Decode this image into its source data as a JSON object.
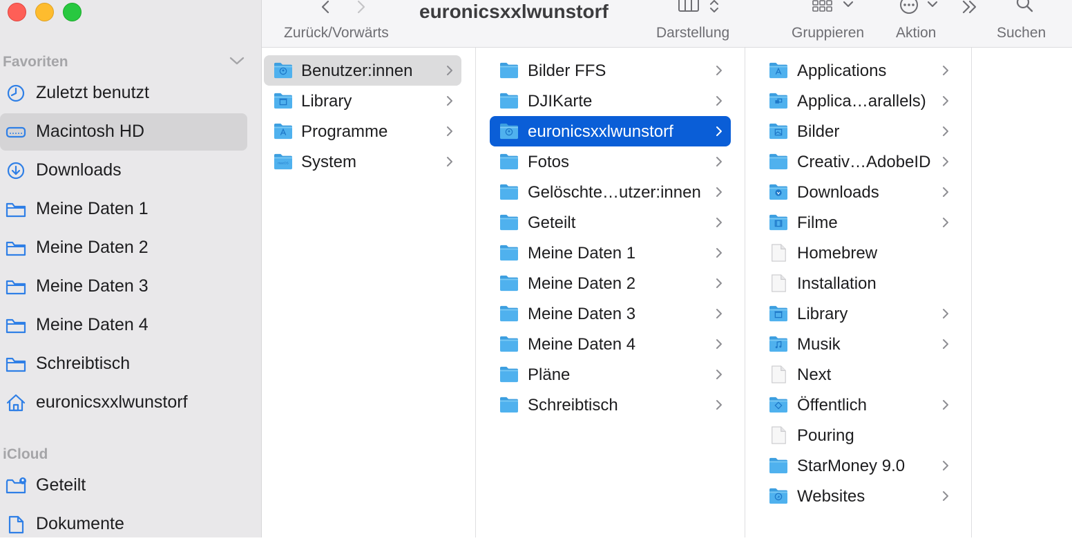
{
  "window": {
    "title": "euronicsxxlwunstorf"
  },
  "toolbar": {
    "back_forward_label": "Zurück/Vorwärts",
    "view_label": "Darstellung",
    "group_label": "Gruppieren",
    "action_label": "Aktion",
    "search_label": "Suchen"
  },
  "sidebar": {
    "favorites_heading": "Favoriten",
    "favorites": [
      {
        "label": "Zuletzt benutzt",
        "icon": "clock-icon"
      },
      {
        "label": "Macintosh HD",
        "icon": "harddrive-icon",
        "selected": true
      },
      {
        "label": "Downloads",
        "icon": "download-circle-icon"
      },
      {
        "label": "Meine Daten 1",
        "icon": "folder-icon"
      },
      {
        "label": "Meine Daten 2",
        "icon": "folder-icon"
      },
      {
        "label": "Meine Daten 3",
        "icon": "folder-icon"
      },
      {
        "label": "Meine Daten 4",
        "icon": "folder-icon"
      },
      {
        "label": "Schreibtisch",
        "icon": "folder-icon"
      },
      {
        "label": "euronicsxxlwunstorf",
        "icon": "home-icon"
      }
    ],
    "icloud_heading": "iCloud",
    "icloud": [
      {
        "label": "Geteilt",
        "icon": "shared-folder-icon"
      },
      {
        "label": "Dokumente",
        "icon": "document-icon"
      }
    ]
  },
  "columns": {
    "col1": [
      {
        "name": "Benutzer:innen",
        "icon": "users-folder-icon",
        "state": "selected-inactive"
      },
      {
        "name": "Library",
        "icon": "library-folder-icon"
      },
      {
        "name": "Programme",
        "icon": "applications-folder-icon"
      },
      {
        "name": "System",
        "icon": "macos-folder-icon"
      }
    ],
    "col2": [
      {
        "name": "Bilder FFS",
        "icon": "folder-icon"
      },
      {
        "name": "DJIKarte",
        "icon": "folder-icon"
      },
      {
        "name": "euronicsxxlwunstorf",
        "icon": "home-folder-icon",
        "state": "selected-active"
      },
      {
        "name": "Fotos",
        "icon": "folder-icon"
      },
      {
        "name": "Gelöschte…utzer:innen",
        "icon": "folder-icon"
      },
      {
        "name": "Geteilt",
        "icon": "folder-icon"
      },
      {
        "name": "Meine Daten 1",
        "icon": "folder-icon"
      },
      {
        "name": "Meine Daten 2",
        "icon": "folder-icon"
      },
      {
        "name": "Meine Daten 3",
        "icon": "folder-icon"
      },
      {
        "name": "Meine Daten 4",
        "icon": "folder-icon"
      },
      {
        "name": "Pläne",
        "icon": "folder-icon"
      },
      {
        "name": "Schreibtisch",
        "icon": "folder-icon"
      }
    ],
    "col3": [
      {
        "name": "Applications",
        "icon": "applications-folder-icon",
        "folder": true
      },
      {
        "name": "Applica…arallels)",
        "icon": "parallels-folder-icon",
        "folder": true
      },
      {
        "name": "Bilder",
        "icon": "pictures-folder-icon",
        "folder": true
      },
      {
        "name": "Creativ…AdobeID",
        "icon": "folder-icon",
        "folder": true
      },
      {
        "name": "Downloads",
        "icon": "downloads-folder-icon",
        "folder": true
      },
      {
        "name": "Filme",
        "icon": "movies-folder-icon",
        "folder": true
      },
      {
        "name": "Homebrew",
        "icon": "file-icon",
        "folder": false
      },
      {
        "name": "Installation",
        "icon": "file-icon",
        "folder": false
      },
      {
        "name": "Library",
        "icon": "library-folder-icon",
        "folder": true
      },
      {
        "name": "Musik",
        "icon": "music-folder-icon",
        "folder": true
      },
      {
        "name": "Next",
        "icon": "file-icon",
        "folder": false
      },
      {
        "name": "Öffentlich",
        "icon": "public-folder-icon",
        "folder": true
      },
      {
        "name": "Pouring",
        "icon": "file-icon",
        "folder": false
      },
      {
        "name": "StarMoney 9.0",
        "icon": "folder-icon",
        "folder": true
      },
      {
        "name": "Websites",
        "icon": "sites-folder-icon",
        "folder": true
      }
    ]
  },
  "colors": {
    "accent": "#0a5ed7",
    "folder": "#4fb1ee",
    "sidebar_icon": "#2f7fe6"
  }
}
